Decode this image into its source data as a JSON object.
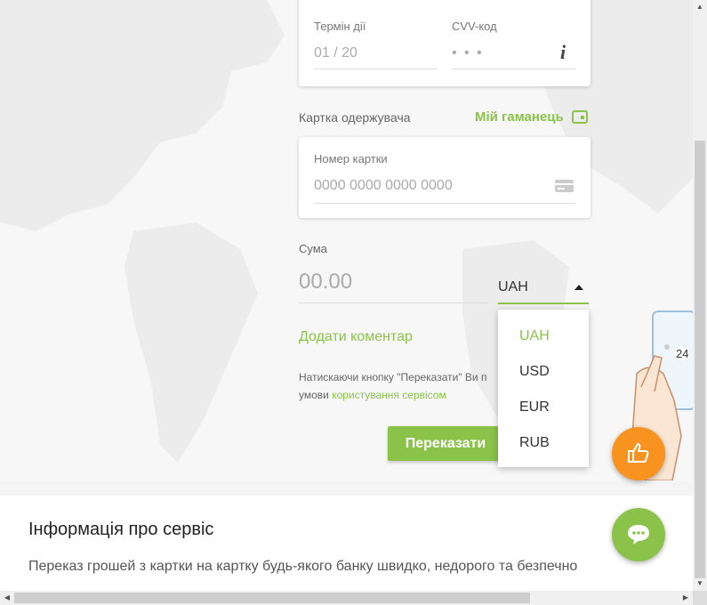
{
  "expiry": {
    "label": "Термін дії",
    "placeholder": "01 / 20"
  },
  "cvv": {
    "label": "CVV-код",
    "placeholder": "• • •",
    "info_glyph": "i"
  },
  "recipient": {
    "label": "Картка одержувача",
    "wallet_link": "Мій гаманець"
  },
  "card_number": {
    "label": "Номер картки",
    "placeholder": "0000 0000 0000 0000"
  },
  "amount": {
    "label": "Сума",
    "placeholder": "00.00"
  },
  "currency": {
    "selected": "UAH",
    "options": [
      "UAH",
      "USD",
      "EUR",
      "RUB"
    ]
  },
  "add_comment": "Додати коментар",
  "terms": {
    "text": "Натискаючи кнопку \"Переказати\" Ви п",
    "text2": "умови ",
    "link": "користування сервісом"
  },
  "submit_label": "Переказати",
  "support_badge": "24",
  "info": {
    "title": "Інформація про сервіс",
    "text": "Переказ грошей з картки на картку будь-якого банку швидко, недорого та безпечно"
  },
  "colors": {
    "accent": "#8bc34a",
    "orange": "#f7931e"
  }
}
